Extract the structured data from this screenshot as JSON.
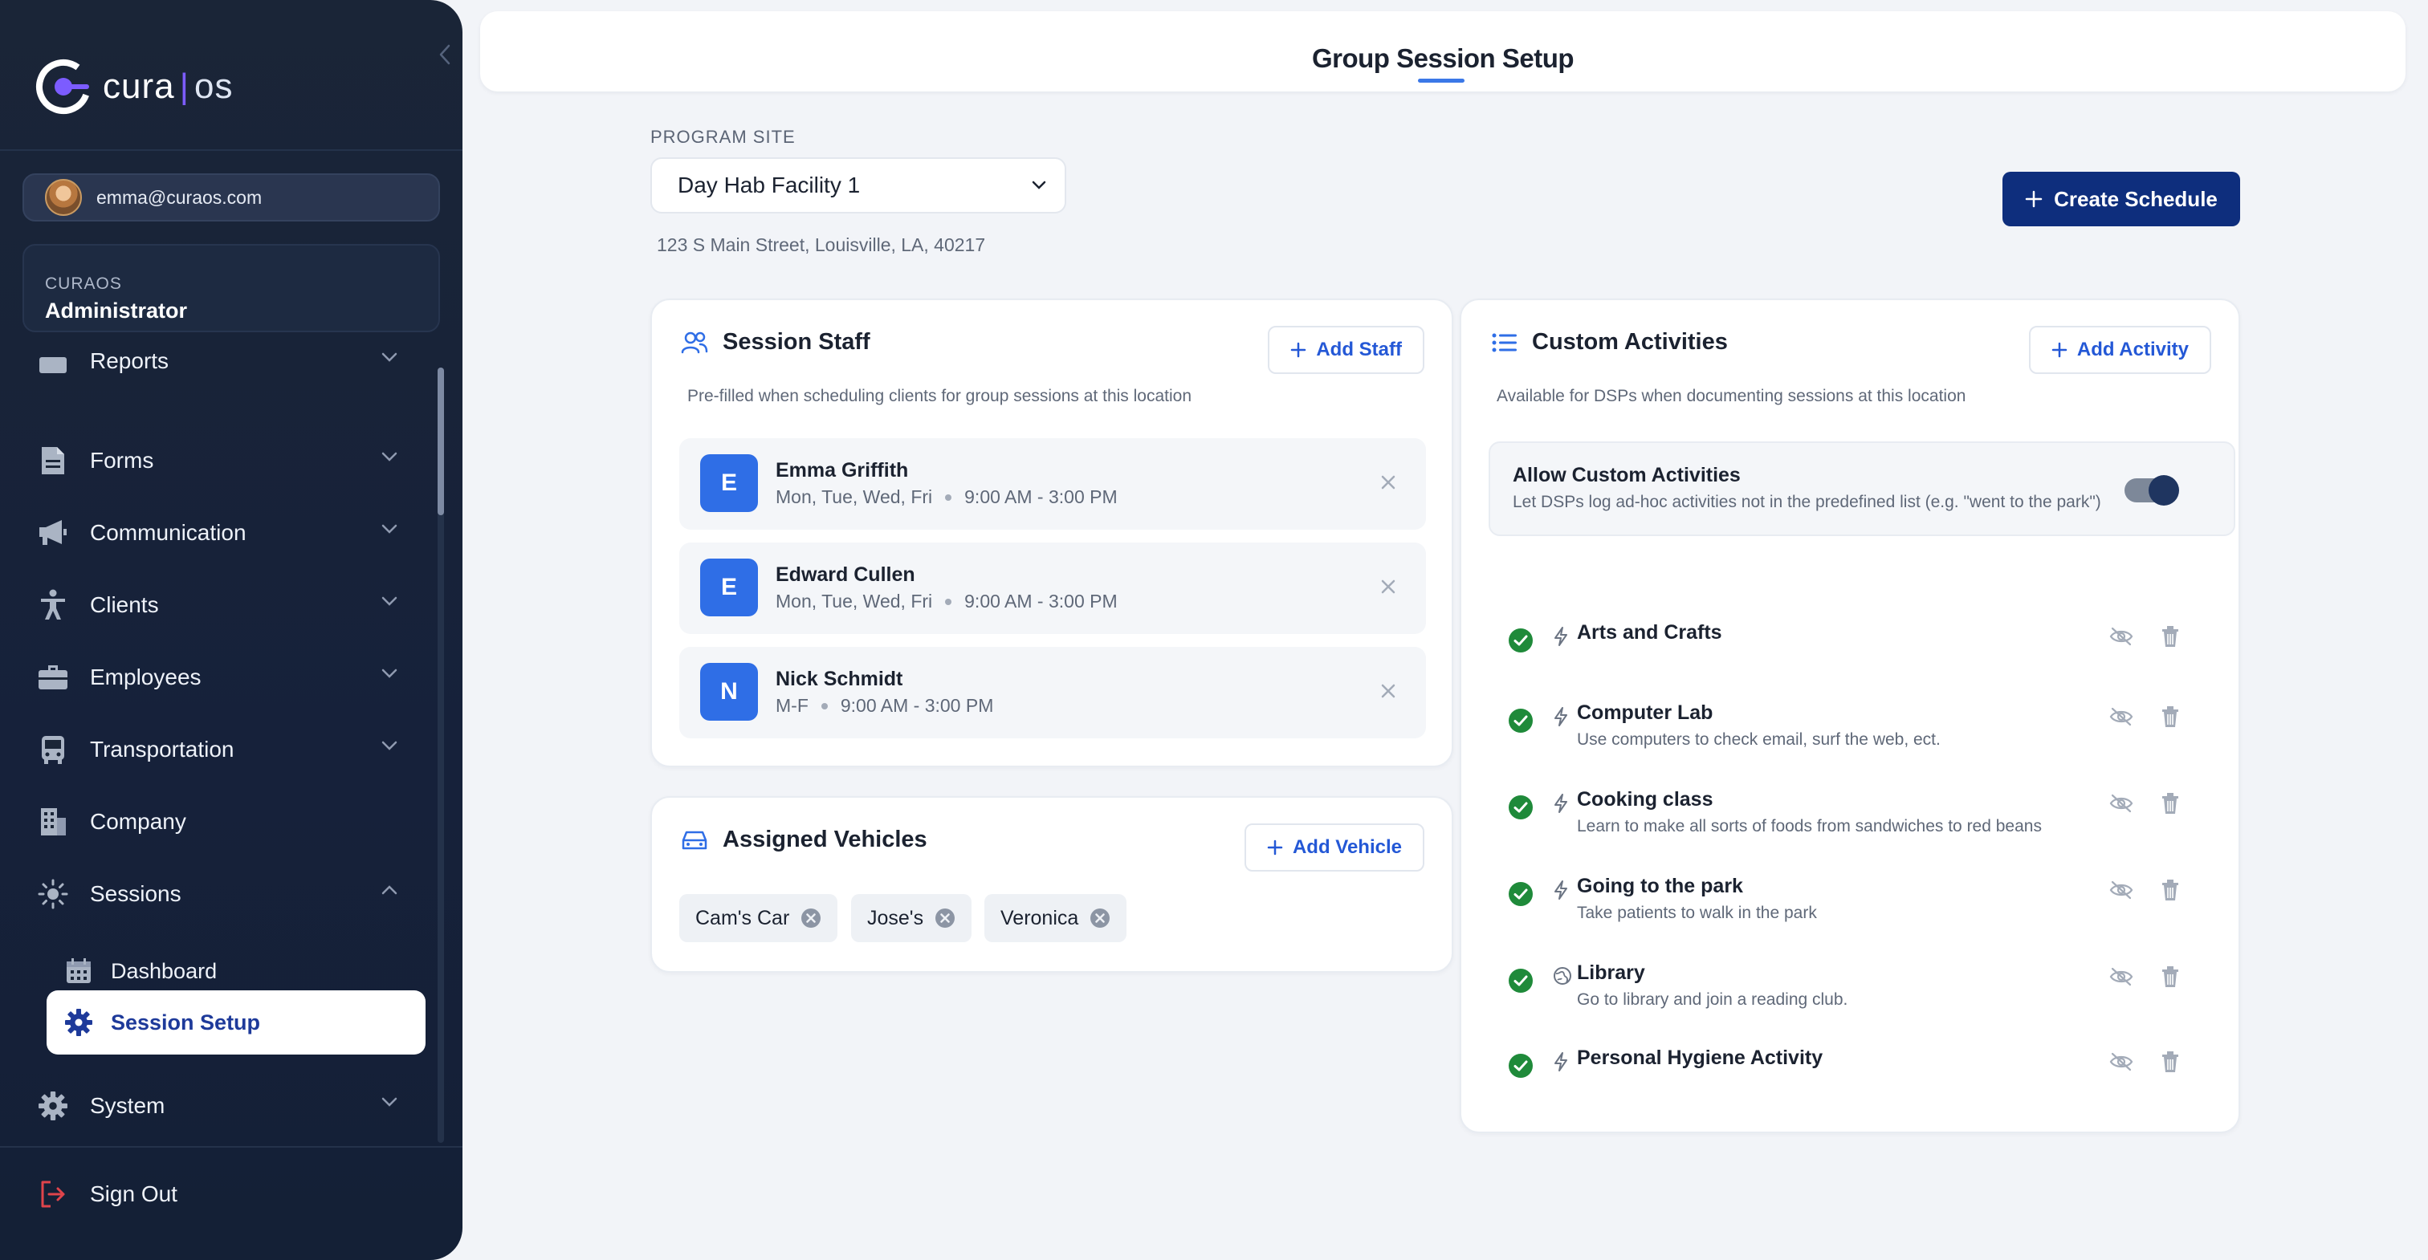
{
  "app": {
    "logo_name": "cura",
    "logo_separator": "|",
    "logo_suffix": "os"
  },
  "sidebar": {
    "user_email": "emma@curaos.com",
    "org": "CURAOS",
    "role": "Administrator",
    "nav": [
      {
        "label": "Reports",
        "icon": "reports-icon",
        "expanded": false
      },
      {
        "label": "Forms",
        "icon": "document-icon",
        "expanded": false
      },
      {
        "label": "Communication",
        "icon": "megaphone-icon",
        "expanded": false
      },
      {
        "label": "Clients",
        "icon": "person-icon",
        "expanded": false
      },
      {
        "label": "Employees",
        "icon": "briefcase-icon",
        "expanded": false
      },
      {
        "label": "Transportation",
        "icon": "bus-icon",
        "expanded": false
      },
      {
        "label": "Company",
        "icon": "building-icon",
        "expanded": false
      },
      {
        "label": "Sessions",
        "icon": "sun-icon",
        "expanded": true
      },
      {
        "label": "System",
        "icon": "gear-icon",
        "expanded": false
      }
    ],
    "sessions_sub": [
      {
        "label": "Dashboard",
        "icon": "calendar-icon",
        "active": false
      },
      {
        "label": "Session Setup",
        "icon": "gear-icon",
        "active": true
      }
    ],
    "sign_out": "Sign Out"
  },
  "header": {
    "title": "Group Session Setup"
  },
  "site": {
    "label": "PROGRAM SITE",
    "selected": "Day Hab Facility 1",
    "address": "123 S Main Street, Louisville, LA, 40217"
  },
  "actions": {
    "create_schedule": "Create Schedule"
  },
  "staff": {
    "title": "Session Staff",
    "subtitle": "Pre-filled when scheduling clients for group sessions at this location",
    "add_label": "Add Staff",
    "members": [
      {
        "initial": "E",
        "name": "Emma Griffith",
        "days": "Mon, Tue, Wed, Fri",
        "hours": "9:00 AM - 3:00 PM"
      },
      {
        "initial": "E",
        "name": "Edward Cullen",
        "days": "Mon, Tue, Wed, Fri",
        "hours": "9:00 AM - 3:00 PM"
      },
      {
        "initial": "N",
        "name": "Nick Schmidt",
        "days": "M-F",
        "hours": "9:00 AM - 3:00 PM"
      }
    ]
  },
  "vehicles": {
    "title": "Assigned Vehicles",
    "add_label": "Add Vehicle",
    "items": [
      "Cam's Car",
      "Jose's",
      "Veronica"
    ]
  },
  "activities": {
    "title": "Custom Activities",
    "subtitle": "Available for DSPs when documenting sessions at this location",
    "add_label": "Add Activity",
    "allow_title": "Allow Custom Activities",
    "allow_desc": "Let DSPs log ad-hoc activities not in the predefined list (e.g. \"went to the park\")",
    "allow_enabled": true,
    "items": [
      {
        "name": "Arts and Crafts",
        "desc": "",
        "icon": "bolt-icon"
      },
      {
        "name": "Computer Lab",
        "desc": "Use computers to check email, surf the web, ect.",
        "icon": "bolt-icon"
      },
      {
        "name": "Cooking class",
        "desc": "Learn to make all sorts of foods from sandwiches to red beans",
        "icon": "bolt-icon"
      },
      {
        "name": "Going to the park",
        "desc": "Take patients to walk in the park",
        "icon": "bolt-icon"
      },
      {
        "name": "Library",
        "desc": "Go to library and join a reading club.",
        "icon": "globe-icon"
      },
      {
        "name": "Personal Hygiene Activity",
        "desc": "",
        "icon": "bolt-icon"
      }
    ]
  },
  "colors": {
    "primary": "#0e2e7d",
    "accent_blue": "#2f6ee6",
    "link_blue": "#2458d6",
    "sidebar_bg": "#1a2537",
    "success_green": "#1f8a3a"
  }
}
